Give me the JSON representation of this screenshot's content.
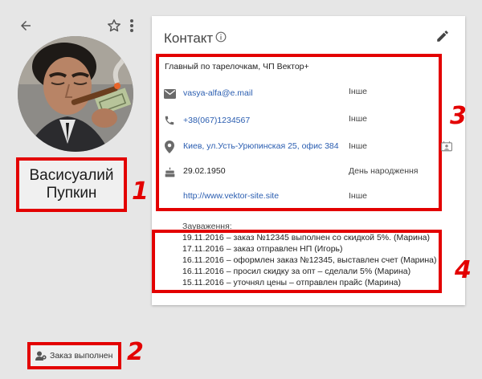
{
  "contact": {
    "name_line1": "Васисуалий",
    "name_line2": "Пупкин",
    "status": "Заказ выполнен"
  },
  "card": {
    "title": "Контакт",
    "company": "Главный по тарелочкам, ЧП Вектор+",
    "rows": [
      {
        "icon": "email-icon",
        "value": "vasya-alfa@e.mail",
        "type": "Інше"
      },
      {
        "icon": "phone-icon",
        "value": "+38(067)1234567",
        "type": "Інше"
      },
      {
        "icon": "location-icon",
        "value": "Киев, ул.Усть-Урюпинская 25, офис 384",
        "type": "Інше"
      },
      {
        "icon": "cake-icon",
        "value": "29.02.1950",
        "type": "День народження"
      },
      {
        "icon": "link-icon",
        "value": "http://www.vektor-site.site",
        "type": "Інше"
      }
    ],
    "notes_label": "Зауваження:",
    "notes": [
      "19.11.2016 – заказ №12345 выполнен со скидкой 5%. (Марина)",
      "17.11.2016 – заказ отправлен НП (Игорь)",
      "16.11.2016 – оформлен заказ №12345, выставлен счет (Марина)",
      "16.11.2016 – просил скидку за опт – сделали 5% (Марина)",
      "15.11.2016 – уточнял цены – отправлен прайс (Марина)"
    ]
  },
  "annotations": [
    "1",
    "2",
    "3",
    "4"
  ],
  "colors": {
    "background": "#e6e6e6",
    "card": "#ffffff",
    "highlight": "#e30000",
    "link": "#2a5db0"
  }
}
